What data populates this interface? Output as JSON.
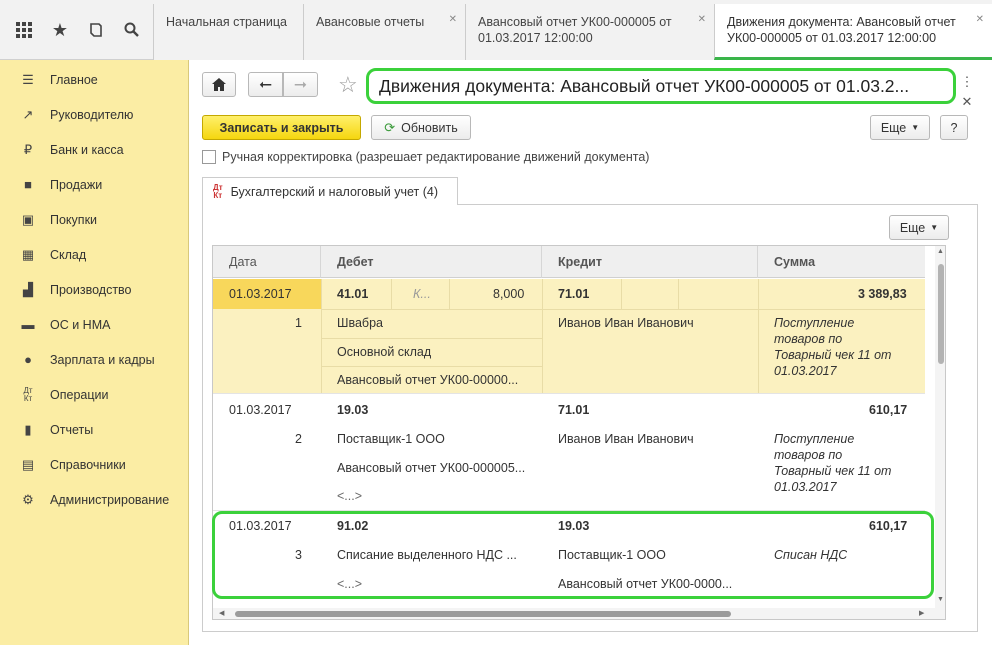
{
  "tabs": [
    {
      "label": "Начальная страница"
    },
    {
      "label": "Авансовые отчеты"
    },
    {
      "label": "Авансовый отчет УК00-000005 от 01.03.2017 12:00:00"
    },
    {
      "label": "Движения документа: Авансовый отчет УК00-000005 от 01.03.2017 12:00:00"
    }
  ],
  "sidebar": {
    "items": [
      {
        "label": "Главное",
        "icon": "menu-icon"
      },
      {
        "label": "Руководителю",
        "icon": "trend-icon"
      },
      {
        "label": "Банк и касса",
        "icon": "ruble-icon"
      },
      {
        "label": "Продажи",
        "icon": "bag-icon"
      },
      {
        "label": "Покупки",
        "icon": "cart-icon"
      },
      {
        "label": "Склад",
        "icon": "warehouse-icon"
      },
      {
        "label": "Производство",
        "icon": "factory-icon"
      },
      {
        "label": "ОС и НМА",
        "icon": "truck-icon"
      },
      {
        "label": "Зарплата и кадры",
        "icon": "people-icon"
      },
      {
        "label": "Операции",
        "icon": "dt-kt-icon"
      },
      {
        "label": "Отчеты",
        "icon": "bar-chart-icon"
      },
      {
        "label": "Справочники",
        "icon": "books-icon"
      },
      {
        "label": "Администрирование",
        "icon": "gear-icon"
      }
    ]
  },
  "header": {
    "title": "Движения документа: Авансовый отчет УК00-000005 от 01.03.2...",
    "save_close": "Записать и закрыть",
    "refresh": "Обновить",
    "more": "Еще",
    "help": "?"
  },
  "manual_edit_label": "Ручная корректировка (разрешает редактирование движений документа)",
  "register_tab": {
    "icon_top": "Дт",
    "icon_bottom": "Кт",
    "label": "Бухгалтерский и налоговый учет (4)"
  },
  "table": {
    "more": "Еще",
    "columns": [
      "Дата",
      "Дебет",
      "Кредит",
      "Сумма"
    ],
    "rows": [
      {
        "date": "01.03.2017",
        "num": "1",
        "debit_account": "41.01",
        "debit_k": "К...",
        "debit_qty": "8,000",
        "debit_lines": [
          "Швабра",
          "Основной склад",
          "Авансовый отчет УК00-00000..."
        ],
        "credit_account": "71.01",
        "credit_lines": [
          "Иванов Иван Иванович"
        ],
        "amount": "3 389,83",
        "content_lines": [
          "Поступление",
          "товаров по",
          "Товарный чек 11 от",
          "01.03.2017"
        ]
      },
      {
        "date": "01.03.2017",
        "num": "2",
        "debit_account": "19.03",
        "debit_lines": [
          "Поставщик-1 ООО",
          "Авансовый отчет УК00-000005...",
          "<...>"
        ],
        "credit_account": "71.01",
        "credit_lines": [
          "Иванов Иван Иванович"
        ],
        "amount": "610,17",
        "content_lines": [
          "Поступление",
          "товаров по",
          "Товарный чек 11 от",
          "01.03.2017"
        ]
      },
      {
        "date": "01.03.2017",
        "num": "3",
        "debit_account": "91.02",
        "debit_lines": [
          "Списание выделенного НДС ...",
          "<...>"
        ],
        "credit_account": "19.03",
        "credit_lines": [
          "Поставщик-1 ООО",
          "Авансовый отчет УК00-0000..."
        ],
        "amount": "610,17",
        "content_lines": [
          "Списан НДС"
        ]
      }
    ]
  }
}
